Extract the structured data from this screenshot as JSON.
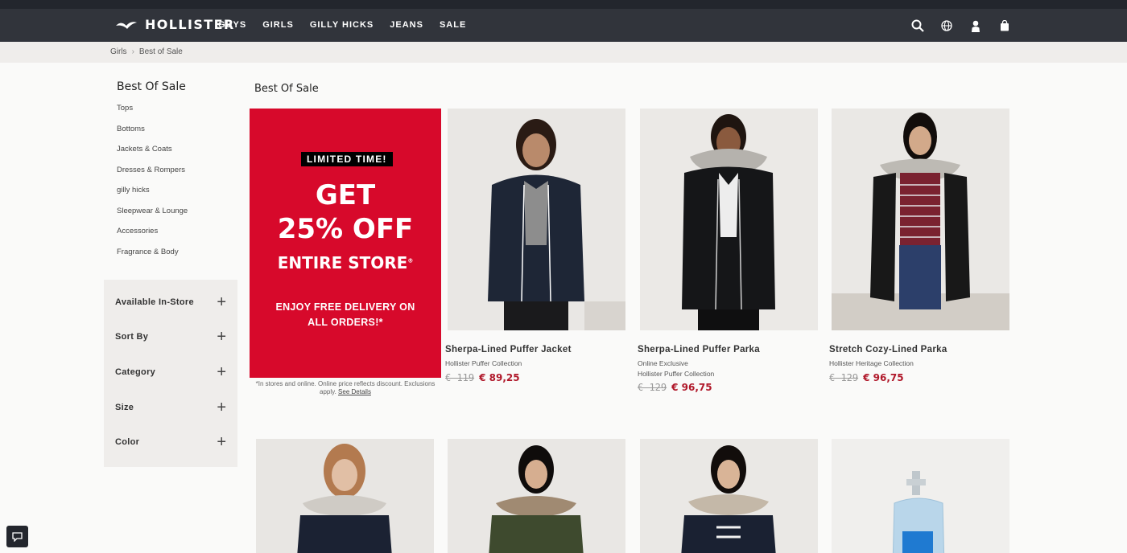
{
  "header": {
    "brand": "HOLLISTER",
    "nav": [
      "GUYS",
      "GIRLS",
      "GILLY HICKS",
      "JEANS",
      "SALE"
    ],
    "icons": [
      "search-icon",
      "globe-icon",
      "account-icon",
      "shopping-bag-icon"
    ]
  },
  "breadcrumb": [
    "Girls",
    "Best of Sale"
  ],
  "sidebar": {
    "title": "Best Of Sale",
    "categories": [
      "Tops",
      "Bottoms",
      "Jackets & Coats",
      "Dresses & Rompers",
      "gilly hicks",
      "Sleepwear & Lounge",
      "Accessories",
      "Fragrance & Body"
    ],
    "filters": [
      "Available In-Store",
      "Sort By",
      "Category",
      "Size",
      "Color"
    ]
  },
  "main": {
    "title": "Best Of Sale"
  },
  "promo": {
    "badge": "LIMITED TIME!",
    "get": "GET",
    "percent": "25% OFF",
    "store": "ENTIRE STORE",
    "store_mark": "®",
    "delivery": "ENJOY FREE DELIVERY ON ALL ORDERS!*",
    "note": "*In stores and online. Online price reflects discount. Exclusions apply.",
    "link": "See Details",
    "color": "#d7092b"
  },
  "products": [
    {
      "name": "Sherpa-Lined Puffer Jacket",
      "subs": [
        "Hollister Puffer Collection"
      ],
      "old_price": "€ 119",
      "new_price": "€ 89,25"
    },
    {
      "name": "Sherpa-Lined Puffer Parka",
      "subs": [
        "Online Exclusive",
        "Hollister Puffer Collection"
      ],
      "old_price": "€ 129",
      "new_price": "€ 96,75"
    },
    {
      "name": "Stretch Cozy-Lined Parka",
      "subs": [
        "Hollister Heritage Collection"
      ],
      "old_price": "€ 129",
      "new_price": "€ 96,75"
    }
  ],
  "colors": {
    "nav_bg": "#31343b",
    "sale_price": "#b0182a"
  }
}
